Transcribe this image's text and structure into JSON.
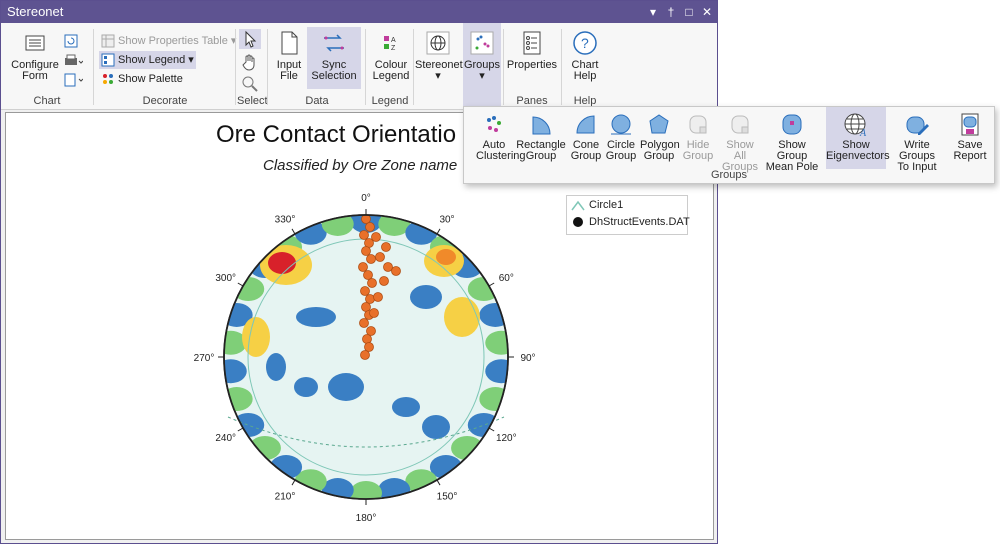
{
  "window": {
    "title": "Stereonet",
    "controls": [
      "▾",
      "†",
      "□",
      "✕"
    ]
  },
  "ribbon": {
    "chart": {
      "label": "Chart",
      "configure_form": "Configure\nForm"
    },
    "decorate": {
      "label": "Decorate",
      "show_properties_table": "Show Properties Table",
      "show_legend": "Show Legend",
      "show_palette": "Show Palette"
    },
    "select": {
      "label": "Select"
    },
    "data": {
      "label": "Data",
      "input_file": "Input\nFile",
      "sync_selection": "Sync\nSelection"
    },
    "legend": {
      "label": "Legend",
      "colour_legend": "Colour\nLegend"
    },
    "stereonet": {
      "label": "Stereonet"
    },
    "groups": {
      "label": "Groups"
    },
    "panes": {
      "label": "Panes",
      "properties": "Properties"
    },
    "help": {
      "label": "Help",
      "chart_help": "Chart\nHelp"
    }
  },
  "flyout": {
    "label": "Groups",
    "buttons": [
      {
        "label": "Auto\nClustering",
        "disabled": false
      },
      {
        "label": "Rectangle\nGroup",
        "disabled": false
      },
      {
        "label": "Cone\nGroup",
        "disabled": false
      },
      {
        "label": "Circle\nGroup",
        "disabled": false
      },
      {
        "label": "Polygon\nGroup",
        "disabled": false
      },
      {
        "label": "Hide\nGroup",
        "disabled": true
      },
      {
        "label": "Show All\nGroups",
        "disabled": true
      },
      {
        "label": "Show Group\nMean Pole",
        "disabled": false
      },
      {
        "label": "Show\nEigenvectors",
        "disabled": false,
        "active": true
      },
      {
        "label": "Write Groups\nTo Input",
        "disabled": false
      },
      {
        "label": "Save\nReport",
        "disabled": false
      }
    ]
  },
  "chart": {
    "title": "Ore Contact Orientatio",
    "subtitle": "Classified by Ore Zone name",
    "angles": [
      "0°",
      "30°",
      "60°",
      "90°",
      "120°",
      "150°",
      "180°",
      "210°",
      "240°",
      "270°",
      "300°",
      "330°"
    ],
    "legend": [
      {
        "name": "Circle1",
        "color": "#7fc7b7"
      },
      {
        "name": "DhStructEvents.DAT",
        "color": "#111111"
      }
    ],
    "colors": {
      "point": "#e8702a",
      "point_stroke": "#b04e14",
      "hot": "#d8212a",
      "warm": "#f6d045",
      "mid": "#7fcf78",
      "cool": "#3a7fc4",
      "bg": "#e6f4f2"
    }
  }
}
